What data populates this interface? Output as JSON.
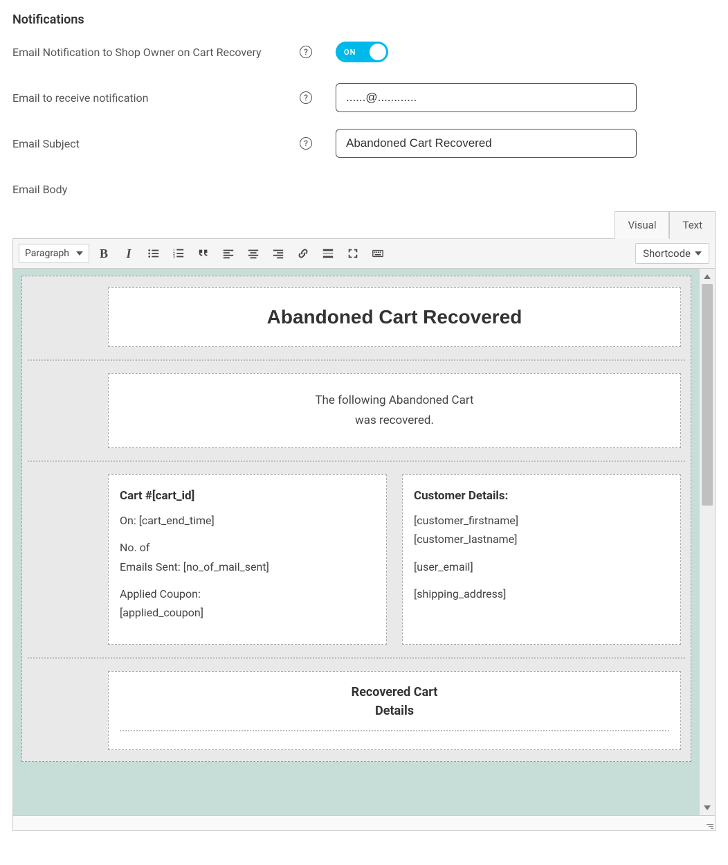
{
  "section_title": "Notifications",
  "fields": {
    "email_notification": {
      "label": "Email Notification to Shop Owner on Cart Recovery",
      "toggle_label": "ON",
      "enabled": true
    },
    "email_to_receive": {
      "label": "Email to receive notification",
      "value": "......@............"
    },
    "email_subject": {
      "label": "Email Subject",
      "value": "Abandoned Cart Recovered"
    },
    "email_body": {
      "label": "Email Body"
    }
  },
  "editor": {
    "tabs": {
      "visual": "Visual",
      "text": "Text",
      "active": "Visual"
    },
    "format_select": "Paragraph",
    "shortcode_label": "Shortcode",
    "content": {
      "heading": "Abandoned Cart Recovered",
      "intro_line1": "The following Abandoned Cart",
      "intro_line2": "was recovered.",
      "cart_col": {
        "title": "Cart #[cart_id]",
        "line_on": "On: [cart_end_time]",
        "line_emails_1": "No. of",
        "line_emails_2": "Emails Sent: [no_of_mail_sent]",
        "line_coupon_1": "Applied Coupon:",
        "line_coupon_2": "[applied_coupon]"
      },
      "customer_col": {
        "title": "Customer Details:",
        "firstname": "[customer_firstname]",
        "lastname": "[customer_lastname]",
        "email": "[user_email]",
        "shipping": "[shipping_address]"
      },
      "recovered_heading_1": "Recovered Cart",
      "recovered_heading_2": "Details"
    }
  }
}
